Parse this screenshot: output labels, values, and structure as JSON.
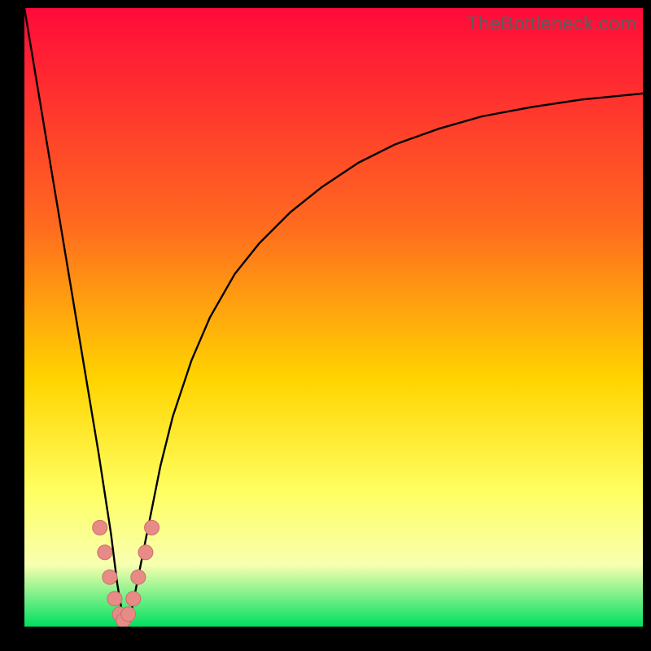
{
  "watermark": "TheBottleneck.com",
  "colors": {
    "gradient_top": "#ff0a3a",
    "gradient_mid1": "#ff6a1f",
    "gradient_mid2": "#ffd400",
    "gradient_mid3": "#ffff60",
    "gradient_mid4": "#f8ffb0",
    "gradient_bottom": "#00e060",
    "curve": "#000000",
    "marker_fill": "#e88b87",
    "marker_stroke": "#c96f6b"
  },
  "chart_data": {
    "type": "line",
    "title": "",
    "xlabel": "",
    "ylabel": "",
    "xlim": [
      0,
      100
    ],
    "ylim": [
      0,
      100
    ],
    "grid": false,
    "legend": false,
    "series": [
      {
        "name": "bottleneck-curve",
        "x": [
          0,
          2,
          4,
          6,
          8,
          10,
          12,
          14,
          15,
          16,
          17,
          18,
          20,
          22,
          24,
          27,
          30,
          34,
          38,
          43,
          48,
          54,
          60,
          67,
          74,
          82,
          90,
          100
        ],
        "values": [
          100,
          88,
          76,
          64,
          52,
          40,
          28,
          15,
          7,
          1,
          1,
          6,
          16,
          26,
          34,
          43,
          50,
          57,
          62,
          67,
          71,
          75,
          78,
          80.5,
          82.5,
          84,
          85.2,
          86.2
        ]
      }
    ],
    "markers": {
      "name": "highlighted-points",
      "x": [
        12.2,
        13.0,
        13.8,
        14.6,
        15.4,
        16.0,
        16.8,
        17.6,
        18.4,
        19.6,
        20.6
      ],
      "values": [
        16,
        12,
        8,
        4.5,
        2,
        1,
        2,
        4.5,
        8,
        12,
        16
      ]
    }
  }
}
